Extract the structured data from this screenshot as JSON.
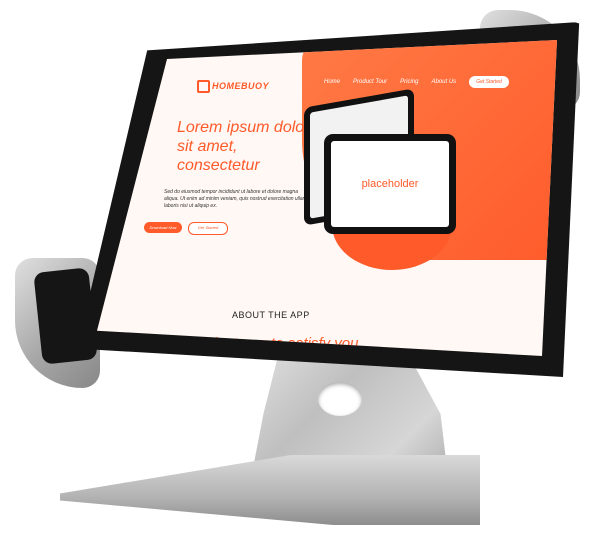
{
  "screen": {
    "logo": "HOMEBUOY",
    "nav": {
      "items": [
        "Home",
        "Product Tour",
        "Pricing",
        "About Us"
      ],
      "cta": "Get Started"
    },
    "hero": {
      "headline": "Lorem ipsum dolor sit amet, consectetur",
      "subtext": "Sed do eiusmod tempor incididunt ut labore et dolore magna aliqua. Ut enim ad minim veniam, quis nostrud exercitation ullamco laboris nisi ut aliquip ex.",
      "primary_button": "Download Now",
      "secondary_button": "Get Started"
    },
    "device_placeholder": "placeholder",
    "about": {
      "label": "ABOUT THE APP",
      "heading": "Wonderful features to satisfy you"
    }
  },
  "colors": {
    "accent": "#ff5a2a",
    "tablet_body": "#151515",
    "stand": "#bfbfbf",
    "background": "#ffffff"
  }
}
